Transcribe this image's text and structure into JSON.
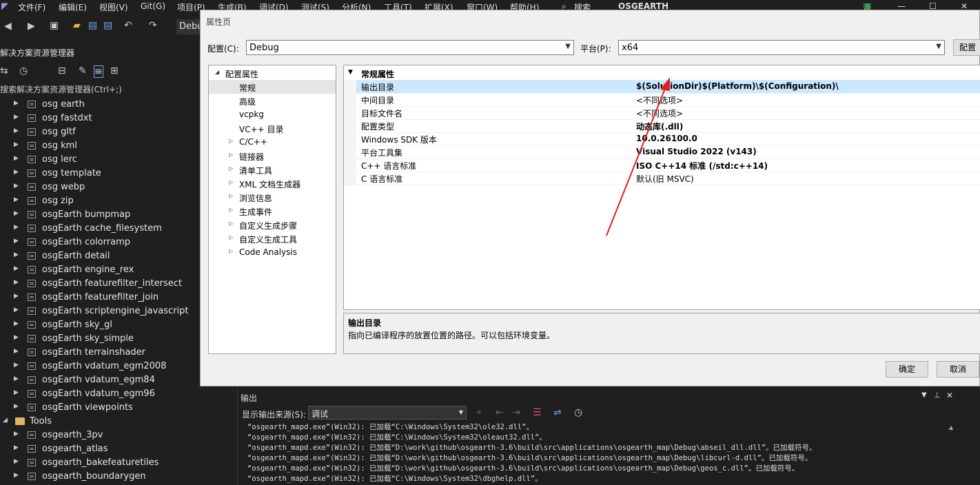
{
  "menu": [
    "文件(F)",
    "编辑(E)",
    "视图(V)",
    "Git(G)",
    "项目(P)",
    "生成(B)",
    "调试(D)",
    "测试(S)",
    "分析(N)",
    "工具(T)",
    "扩展(X)",
    "窗口(W)",
    "帮助(H)"
  ],
  "search_label": "搜索",
  "solution_name": "OSGEARTH",
  "source_badge": "源",
  "toolbar_config": "Debu",
  "solution_explorer": {
    "title": "解决方案资源管理器",
    "search_placeholder": "搜索解决方案资源管理器(Ctrl+;)",
    "items": [
      "osg earth",
      "osg fastdxt",
      "osg gltf",
      "osg kml",
      "osg lerc",
      "osg template",
      "osg webp",
      "osg zip",
      "osgEarth bumpmap",
      "osgEarth cache_filesystem",
      "osgEarth colorramp",
      "osgEarth detail",
      "osgEarth engine_rex",
      "osgEarth featurefilter_intersect",
      "osgEarth featurefilter_join",
      "osgEarth scriptengine_javascript",
      "osgEarth sky_gl",
      "osgEarth sky_simple",
      "osgEarth terrainshader",
      "osgEarth vdatum_egm2008",
      "osgEarth vdatum_egm84",
      "osgEarth vdatum_egm96",
      "osgEarth viewpoints"
    ],
    "folder": "Tools",
    "tools_items": [
      "osgearth_3pv",
      "osgearth_atlas",
      "osgearth_bakefeaturetiles",
      "osgearth_boundarygen"
    ]
  },
  "dialog": {
    "title": "属性页",
    "config_label": "配置(C):",
    "config_value": "Debug",
    "platform_label": "平台(P):",
    "platform_value": "x64",
    "config_manager_button": "配置管",
    "nav": {
      "root": "配置属性",
      "items": [
        {
          "label": "常规",
          "expandable": false
        },
        {
          "label": "高级",
          "expandable": false
        },
        {
          "label": "vcpkg",
          "expandable": false
        },
        {
          "label": "VC++ 目录",
          "expandable": false
        },
        {
          "label": "C/C++",
          "expandable": true
        },
        {
          "label": "链接器",
          "expandable": true
        },
        {
          "label": "清单工具",
          "expandable": true
        },
        {
          "label": "XML 文档生成器",
          "expandable": true
        },
        {
          "label": "浏览信息",
          "expandable": true
        },
        {
          "label": "生成事件",
          "expandable": true
        },
        {
          "label": "自定义生成步骤",
          "expandable": true
        },
        {
          "label": "自定义生成工具",
          "expandable": true
        },
        {
          "label": "Code Analysis",
          "expandable": true
        }
      ]
    },
    "section": "常规属性",
    "properties": [
      {
        "name": "输出目录",
        "value": "$(SolutionDir)$(Platform)\\$(Configuration)\\",
        "bold": true
      },
      {
        "name": "中间目录",
        "value": "<不同选项>",
        "bold": false
      },
      {
        "name": "目标文件名",
        "value": "<不同选项>",
        "bold": false
      },
      {
        "name": "配置类型",
        "value": "动态库(.dll)",
        "bold": true
      },
      {
        "name": "Windows SDK 版本",
        "value": "10.0.26100.0",
        "bold": true
      },
      {
        "name": "平台工具集",
        "value": "Visual Studio 2022 (v143)",
        "bold": true
      },
      {
        "name": "C++ 语言标准",
        "value": "ISO C++14 标准 (/std:c++14)",
        "bold": true
      },
      {
        "name": "C 语言标准",
        "value": "默认(旧 MSVC)",
        "bold": false
      }
    ],
    "description_title": "输出目录",
    "description_text": "指向已编译程序的放置位置的路径。可以包括环境变量。",
    "ok_button": "确定",
    "cancel_button": "取消",
    "accent_color": "#cce8ff"
  },
  "output": {
    "title": "输出",
    "source_label": "显示输出来源(S):",
    "source_value": "调试",
    "lines": [
      "“osgearth_mapd.exe”(Win32): 已加载“C:\\Windows\\System32\\ole32.dll”。",
      "“osgearth_mapd.exe”(Win32): 已加载“C:\\Windows\\System32\\oleaut32.dll”。",
      "“osgearth_mapd.exe”(Win32): 已加载“D:\\work\\github\\osgearth-3.6\\build\\src\\applications\\osgearth_map\\Debug\\abseil_dll.dll”。已加载符号。",
      "“osgearth_mapd.exe”(Win32): 已加载“D:\\work\\github\\osgearth-3.6\\build\\src\\applications\\osgearth_map\\Debug\\libcurl-d.dll”。已加载符号。",
      "“osgearth_mapd.exe”(Win32): 已加载“D:\\work\\github\\osgearth-3.6\\build\\src\\applications\\osgearth_map\\Debug\\geos_c.dll”。已加载符号。",
      "“osgearth_mapd.exe”(Win32): 已加载“C:\\Windows\\System32\\dbghelp.dll”。"
    ]
  }
}
